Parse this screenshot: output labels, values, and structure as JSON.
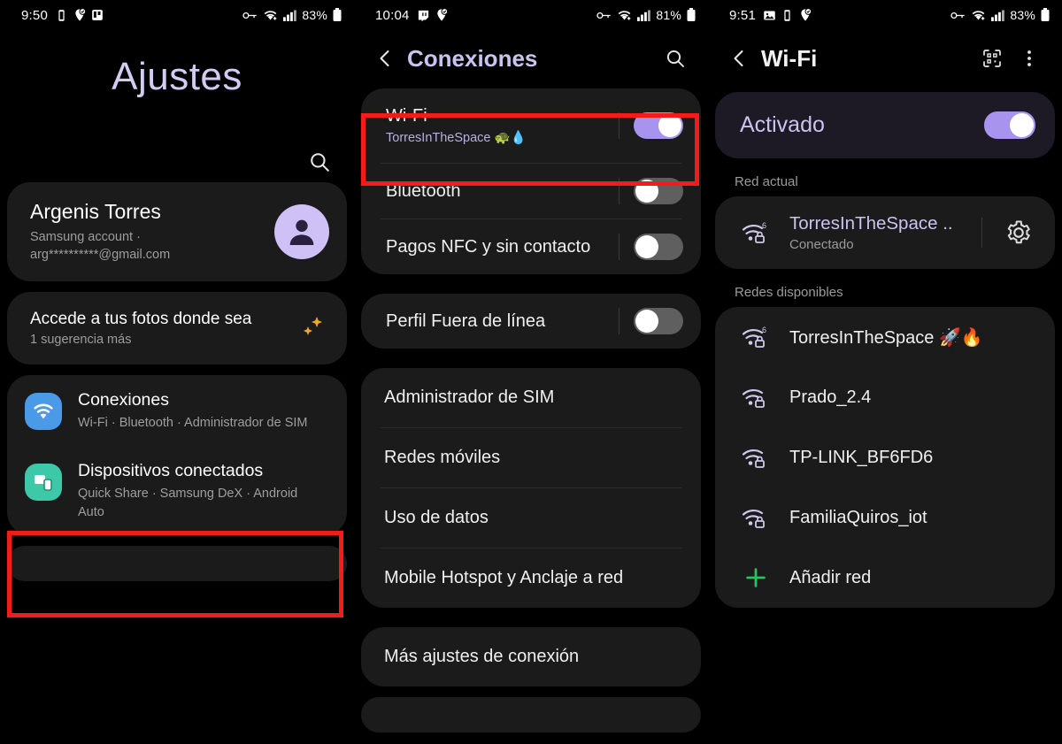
{
  "colors": {
    "accent_lavender": "#ccc2f0",
    "toggle_on": "#a894ee",
    "toggle_off": "#5f5f5f",
    "highlight_red": "#f41b1b",
    "wifi_icon_blue": "#4a9ae8",
    "devices_icon_teal": "#3dc9a8",
    "add_network_green": "#22c55e",
    "card_bg": "#1b1b1b",
    "screen_bg": "#000000"
  },
  "panel1": {
    "statusbar": {
      "time": "9:50",
      "battery": "83%",
      "left_icons": [
        "vibrate-icon",
        "location-check-icon",
        "trello-icon"
      ],
      "right_icons": [
        "vpn-key-icon",
        "wifi-icon",
        "signal-bars-icon",
        "battery-icon"
      ]
    },
    "page_title": "Ajustes",
    "search_icon": "search-icon",
    "account": {
      "name": "Argenis Torres",
      "subtitle_line1": "Samsung account  ·",
      "subtitle_line2": "arg**********@gmail.com",
      "avatar": "person-avatar-icon"
    },
    "suggestion": {
      "title": "Accede a tus fotos donde sea",
      "subtitle": "1 sugerencia más",
      "icon": "sparkles-icon"
    },
    "items": [
      {
        "title": "Conexiones",
        "subtitle": "Wi-Fi · Bluetooth · Administrador de SIM",
        "icon": "wifi-icon",
        "highlighted": true
      },
      {
        "title": "Dispositivos conectados",
        "subtitle": "Quick Share · Samsung DeX · Android Auto",
        "icon": "connected-devices-icon",
        "highlighted": false
      }
    ]
  },
  "panel2": {
    "statusbar": {
      "time": "10:04",
      "battery": "81%",
      "left_icons": [
        "twitch-icon",
        "location-check-icon"
      ],
      "right_icons": [
        "vpn-key-icon",
        "wifi-icon",
        "signal-bars-icon",
        "battery-icon"
      ]
    },
    "appbar": {
      "back_icon": "back-chevron-icon",
      "title": "Conexiones",
      "search_icon": "search-icon"
    },
    "group1": [
      {
        "label": "Wi-Fi",
        "sublabel": "TorresInTheSpace 🐢💧",
        "toggle": "on",
        "highlighted": true
      },
      {
        "label": "Bluetooth",
        "toggle": "off",
        "highlighted": false
      },
      {
        "label": "Pagos NFC y sin contacto",
        "toggle": "off",
        "highlighted": false
      }
    ],
    "group2": [
      {
        "label": "Perfil Fuera de línea",
        "toggle": "off"
      }
    ],
    "group3": [
      "Administrador de SIM",
      "Redes móviles",
      "Uso de datos",
      "Mobile Hotspot y Anclaje a red"
    ],
    "group4": [
      "Más ajustes de conexión"
    ]
  },
  "panel3": {
    "statusbar": {
      "time": "9:51",
      "battery": "83%",
      "left_icons": [
        "image-icon",
        "vibrate-icon",
        "location-check-icon"
      ],
      "right_icons": [
        "vpn-key-icon",
        "wifi-icon",
        "signal-bars-icon",
        "battery-icon"
      ]
    },
    "appbar": {
      "back_icon": "back-chevron-icon",
      "title": "Wi-Fi",
      "qr_icon": "qr-scan-icon",
      "menu_icon": "overflow-menu-icon"
    },
    "master_toggle": {
      "label": "Activado",
      "state": "on"
    },
    "current_section_label": "Red actual",
    "current_network": {
      "name": "TorresInTheSpace ..",
      "status": "Conectado",
      "icon": "wifi6-lock-icon",
      "gear_icon": "gear-icon",
      "gear_highlighted": true
    },
    "available_section_label": "Redes disponibles",
    "available_networks": [
      {
        "name": "TorresInTheSpace 🚀🔥",
        "icon": "wifi6-lock-icon"
      },
      {
        "name": "Prado_2.4",
        "icon": "wifi-lock-icon"
      },
      {
        "name": "TP-LINK_BF6FD6",
        "icon": "wifi-lock-icon"
      },
      {
        "name": "FamiliaQuiros_iot",
        "icon": "wifi-lock-icon"
      }
    ],
    "add_network": {
      "label": "Añadir red",
      "icon": "plus-icon"
    }
  }
}
